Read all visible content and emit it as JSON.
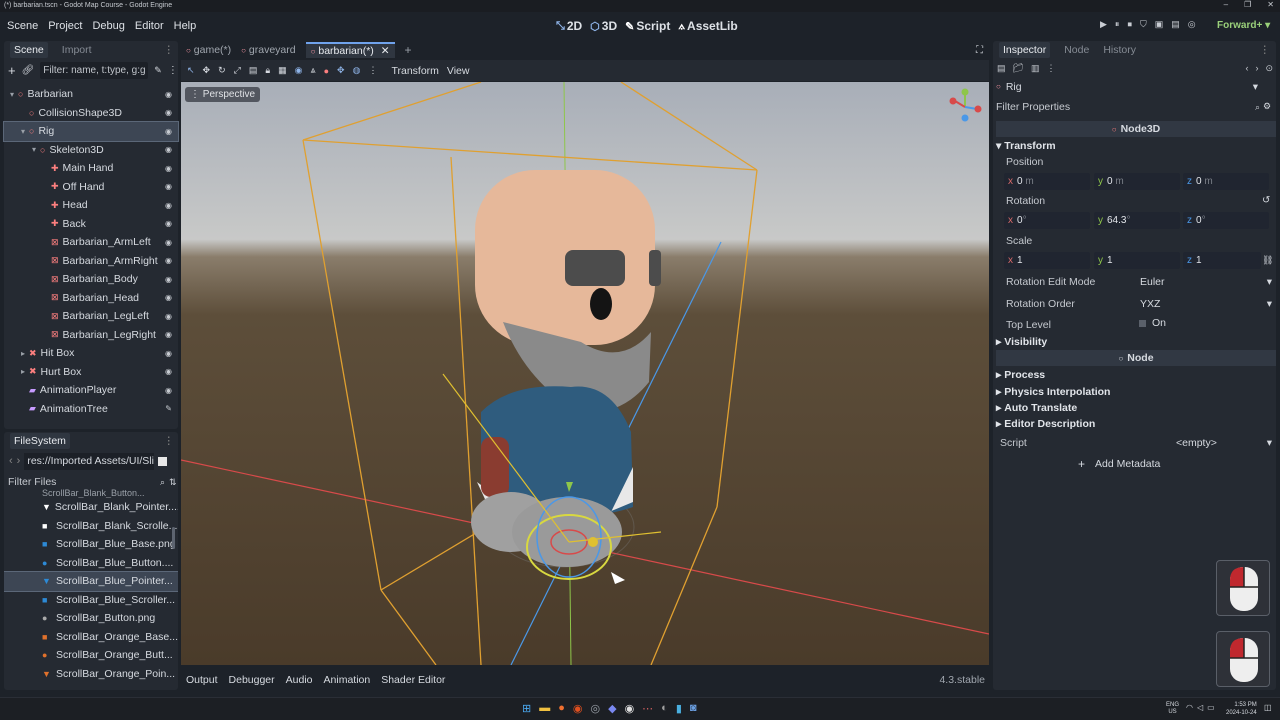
{
  "window": {
    "title": "(*) barbarian.tscn - Godot Map Course - Godot Engine",
    "controls": [
      "–",
      "❐",
      "✕"
    ]
  },
  "menu": [
    "Scene",
    "Project",
    "Debug",
    "Editor",
    "Help"
  ],
  "modes": [
    {
      "icon": "2d-icon",
      "label": "2D"
    },
    {
      "icon": "3d-icon",
      "label": "3D"
    },
    {
      "icon": "script-icon",
      "label": "Script"
    },
    {
      "icon": "assetlib-icon",
      "label": "AssetLib"
    }
  ],
  "play_controls": [
    "▶",
    "⏸",
    "⏹",
    "⛉",
    "▣",
    "▤",
    "◎"
  ],
  "renderer": "Forward+",
  "scene_dock": {
    "tabs": [
      "Scene",
      "Import"
    ],
    "filter_placeholder": "Filter: name, t:type, g:g",
    "tree": [
      {
        "name": "Barbarian",
        "icon": "node3d-icon",
        "color": "#fc7f7f",
        "indent": 0,
        "arrow": "▾"
      },
      {
        "name": "CollisionShape3D",
        "icon": "collision-icon",
        "color": "#fc7f7f",
        "indent": 1,
        "arrow": ""
      },
      {
        "name": "Rig",
        "icon": "node3d-icon",
        "color": "#fc7f7f",
        "indent": 1,
        "arrow": "▾",
        "selected": true
      },
      {
        "name": "Skeleton3D",
        "icon": "skeleton-icon",
        "color": "#fc7f7f",
        "indent": 2,
        "arrow": "▾"
      },
      {
        "name": "Main Hand",
        "icon": "bone-attachment-icon",
        "color": "#fc7f7f",
        "indent": 3,
        "arrow": ""
      },
      {
        "name": "Off Hand",
        "icon": "bone-attachment-icon",
        "color": "#fc7f7f",
        "indent": 3,
        "arrow": ""
      },
      {
        "name": "Head",
        "icon": "bone-attachment-icon",
        "color": "#fc7f7f",
        "indent": 3,
        "arrow": ""
      },
      {
        "name": "Back",
        "icon": "bone-attachment-icon",
        "color": "#fc7f7f",
        "indent": 3,
        "arrow": ""
      },
      {
        "name": "Barbarian_ArmLeft",
        "icon": "mesh-icon",
        "color": "#fc7f7f",
        "indent": 3,
        "arrow": ""
      },
      {
        "name": "Barbarian_ArmRight",
        "icon": "mesh-icon",
        "color": "#fc7f7f",
        "indent": 3,
        "arrow": ""
      },
      {
        "name": "Barbarian_Body",
        "icon": "mesh-icon",
        "color": "#fc7f7f",
        "indent": 3,
        "arrow": ""
      },
      {
        "name": "Barbarian_Head",
        "icon": "mesh-icon",
        "color": "#fc7f7f",
        "indent": 3,
        "arrow": ""
      },
      {
        "name": "Barbarian_LegLeft",
        "icon": "mesh-icon",
        "color": "#fc7f7f",
        "indent": 3,
        "arrow": ""
      },
      {
        "name": "Barbarian_LegRight",
        "icon": "mesh-icon",
        "color": "#fc7f7f",
        "indent": 3,
        "arrow": ""
      },
      {
        "name": "Hit Box",
        "icon": "area-icon",
        "color": "#fc7f7f",
        "indent": 1,
        "arrow": "▸"
      },
      {
        "name": "Hurt Box",
        "icon": "area-icon",
        "color": "#fc7f7f",
        "indent": 1,
        "arrow": "▸"
      },
      {
        "name": "AnimationPlayer",
        "icon": "animation-player-icon",
        "color": "#c79bff",
        "indent": 1,
        "arrow": ""
      },
      {
        "name": "AnimationTree",
        "icon": "animation-tree-icon",
        "color": "#c79bff",
        "indent": 1,
        "arrow": ""
      }
    ]
  },
  "filesystem": {
    "title": "FileSystem",
    "path": "res://Imported Assets/UI/Sli",
    "filter_placeholder": "Filter Files",
    "files": [
      {
        "name": "ScrollBar_Blank_Pointer....",
        "icon": "▼",
        "color": "#ffffff"
      },
      {
        "name": "ScrollBar_Blank_Scrolle...",
        "icon": "■",
        "color": "#ffffff"
      },
      {
        "name": "ScrollBar_Blue_Base.png",
        "icon": "■",
        "color": "#2d8ad6"
      },
      {
        "name": "ScrollBar_Blue_Button....",
        "icon": "●",
        "color": "#2d8ad6"
      },
      {
        "name": "ScrollBar_Blue_Pointer...",
        "icon": "▼",
        "color": "#2d8ad6",
        "selected": true
      },
      {
        "name": "ScrollBar_Blue_Scroller...",
        "icon": "■",
        "color": "#2d8ad6"
      },
      {
        "name": "ScrollBar_Button.png",
        "icon": "●",
        "color": "#aaaaaa"
      },
      {
        "name": "ScrollBar_Orange_Base...",
        "icon": "■",
        "color": "#e0712c"
      },
      {
        "name": "ScrollBar_Orange_Butt...",
        "icon": "●",
        "color": "#e0712c"
      },
      {
        "name": "ScrollBar_Orange_Poin...",
        "icon": "▼",
        "color": "#e0712c"
      }
    ]
  },
  "editor_tabs": [
    {
      "label": "game(*)",
      "active": false
    },
    {
      "label": "graveyard",
      "active": false
    },
    {
      "label": "barbarian(*)",
      "active": true
    }
  ],
  "viewport": {
    "menus": [
      "Transform",
      "View"
    ],
    "perspective_label": "Perspective"
  },
  "bottom_panel": {
    "tabs": [
      "Output",
      "Debugger",
      "Audio",
      "Animation",
      "Shader Editor"
    ],
    "version": "4.3.stable"
  },
  "inspector": {
    "tabs": [
      "Inspector",
      "Node",
      "History"
    ],
    "node_name": "Rig",
    "filter_placeholder": "Filter Properties",
    "class_header": "Node3D",
    "transform_section": "Transform",
    "position_label": "Position",
    "position": {
      "x": "0",
      "y": "0",
      "z": "0",
      "unit": "m"
    },
    "rotation_label": "Rotation",
    "rotation": {
      "x": "0",
      "y": "64.3",
      "z": "0",
      "unit": "°"
    },
    "scale_label": "Scale",
    "scale": {
      "x": "1",
      "y": "1",
      "z": "1"
    },
    "rotation_edit_mode_label": "Rotation Edit Mode",
    "rotation_edit_mode": "Euler",
    "rotation_order_label": "Rotation Order",
    "rotation_order": "YXZ",
    "top_level_label": "Top Level",
    "top_level_value": "On",
    "visibility_section": "Visibility",
    "node_header": "Node",
    "process_section": "Process",
    "physics_interp_section": "Physics Interpolation",
    "auto_translate_section": "Auto Translate",
    "editor_desc_section": "Editor Description",
    "script_label": "Script",
    "script_value": "<empty>",
    "add_metadata": "Add Metadata"
  },
  "taskbar": {
    "lang": "ENG",
    "region": "US",
    "time": "1:53 PM",
    "date": "2024-10-24"
  }
}
